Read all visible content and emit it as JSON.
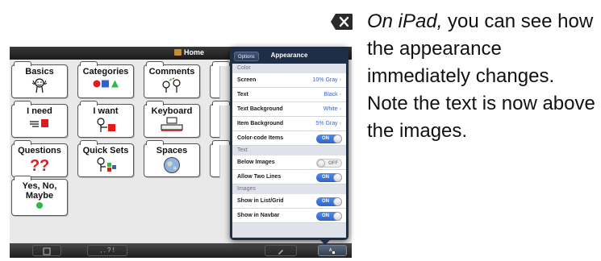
{
  "navbar": {
    "title": "Home"
  },
  "tiles": [
    {
      "label": "Basics",
      "icon": "waving-person-icon"
    },
    {
      "label": "Categories",
      "icon": "shapes-icon"
    },
    {
      "label": "Comments",
      "icon": "talking-people-icon"
    },
    {
      "label": "I need",
      "icon": "reaching-hand-icon"
    },
    {
      "label": "I want",
      "icon": "person-wanting-icon"
    },
    {
      "label": "Keyboard",
      "icon": "keyboard-icon"
    },
    {
      "label": "Questions",
      "icon": "question-marks-icon"
    },
    {
      "label": "Quick Sets",
      "icon": "person-blocks-icon"
    },
    {
      "label": "Spaces",
      "icon": "globe-icon"
    },
    {
      "label": "Yes, No, Maybe",
      "icon": "green-dot-icon"
    }
  ],
  "popover": {
    "back_label": "Options",
    "title": "Appearance",
    "sections": {
      "color": "Color",
      "text": "Text",
      "images": "Images"
    },
    "rows": {
      "screen": {
        "label": "Screen",
        "value": "10% Gray"
      },
      "text": {
        "label": "Text",
        "value": "Black"
      },
      "text_background": {
        "label": "Text Background",
        "value": "White"
      },
      "item_background": {
        "label": "Item Background",
        "value": "5% Gray"
      },
      "color_code": {
        "label": "Color-code Items",
        "state": "ON"
      },
      "below_images": {
        "label": "Below Images",
        "state": "OFF"
      },
      "allow_two_lines": {
        "label": "Allow Two Lines",
        "state": "ON"
      },
      "show_list_grid": {
        "label": "Show in List/Grid",
        "state": "ON"
      },
      "show_navbar": {
        "label": "Show in Navbar",
        "state": "ON"
      }
    }
  },
  "toolbar": {
    "punct_label": ", . ? !"
  },
  "caption": {
    "italic": "On iPad,",
    "rest": " you can see how the appearance immediately changes. Note the text is now above the images."
  },
  "colors": {
    "popover_bg": "#1f2d46",
    "toggle_on": "#3b74db",
    "value_text": "#3d63c3",
    "red": "#e01b1b",
    "green": "#2db84a",
    "blue": "#2f63c7"
  }
}
